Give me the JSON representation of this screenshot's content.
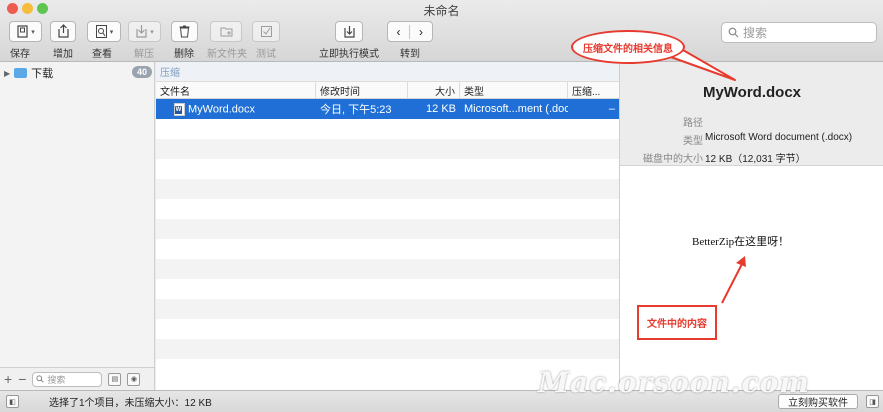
{
  "window": {
    "title": "未命名"
  },
  "toolbar": {
    "save": "保存",
    "add": "增加",
    "view": "查看",
    "extract": "解压",
    "delete": "删除",
    "new_folder": "新文件夹",
    "test": "测试",
    "run_now": "立即执行模式",
    "goto": "转到"
  },
  "search": {
    "placeholder": "搜索"
  },
  "sidebar": {
    "items": [
      {
        "label": "下载",
        "badge": "40"
      }
    ],
    "search_placeholder": "搜索"
  },
  "main": {
    "path": "压缩",
    "columns": [
      "文件名",
      "修改时间",
      "大小",
      "类型",
      "压缩..."
    ],
    "rows": [
      {
        "name": "MyWord.docx",
        "date": "今日, 下午5:23",
        "size": "12 KB",
        "type": "Microsoft...ment (.docx)",
        "comp": "–"
      }
    ]
  },
  "info": {
    "title": "MyWord.docx",
    "path_label": "路径",
    "path_value": "",
    "type_label": "类型",
    "type_value": "Microsoft Word document (.docx)",
    "disk_label": "磁盘中的大小",
    "disk_value": "12 KB（12,031 字节）",
    "preview_text": "BetterZip在这里呀！"
  },
  "annotations": {
    "callout": "压缩文件的相关信息",
    "content_box": "文件中的内容",
    "color": "#e73b2f"
  },
  "watermark": "Mac.orsoon.com",
  "status": {
    "text": "选择了1个项目，未压缩大小：12 KB",
    "buy": "立刻购买软件"
  },
  "colors": {
    "selection": "#1f6fd6",
    "folder": "#5aa8e8"
  }
}
